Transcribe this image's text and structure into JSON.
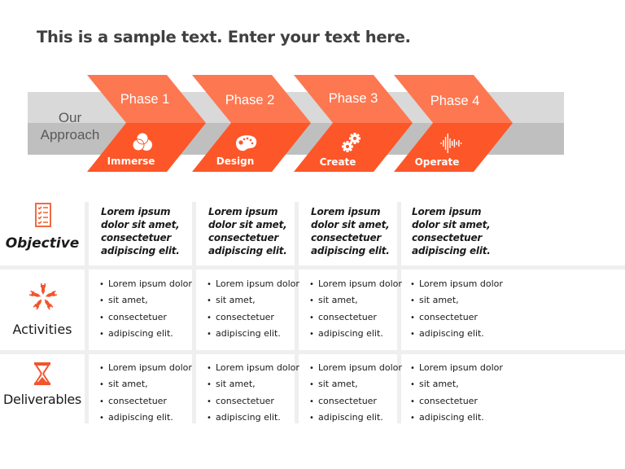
{
  "title": "This is a sample text. Enter your text here.",
  "colors": {
    "accent_light": "#fd7751",
    "accent_dark": "#fd5628",
    "band_light": "#d9d9d9",
    "band_dark": "#bfbfbf",
    "grid_line": "#efefef"
  },
  "approach": {
    "line1": "Our",
    "line2": "Approach"
  },
  "phases": [
    {
      "label": "Phase 1",
      "sub": "Immerse",
      "icon": "venn-circles-icon"
    },
    {
      "label": "Phase 2",
      "sub": "Design",
      "icon": "paint-palette-icon"
    },
    {
      "label": "Phase 3",
      "sub": "Create",
      "icon": "gears-icon"
    },
    {
      "label": "Phase 4",
      "sub": "Operate",
      "icon": "sound-wave-icon"
    }
  ],
  "rows": [
    {
      "label": "Objective",
      "icon": "checklist-icon",
      "cells": [
        "Lorem ipsum dolor sit amet, consectetuer adipiscing elit.",
        "Lorem ipsum dolor sit amet, consectetuer adipiscing elit.",
        "Lorem ipsum dolor sit amet, consectetuer adipiscing elit.",
        "Lorem ipsum dolor sit amet, consectetuer adipiscing elit."
      ],
      "cell_lines": [
        "Lorem ipsum",
        "dolor sit amet,",
        "consectetuer",
        "adipiscing elit."
      ]
    },
    {
      "label": "Activities",
      "icon": "hands-teamwork-icon",
      "bullets": [
        "Lorem ipsum dolor",
        "sit amet,",
        "consectetuer",
        "adipiscing elit."
      ]
    },
    {
      "label": "Deliverables",
      "icon": "hourglass-icon",
      "bullets": [
        "Lorem ipsum dolor",
        "sit amet,",
        "consectetuer",
        "adipiscing elit."
      ]
    }
  ]
}
